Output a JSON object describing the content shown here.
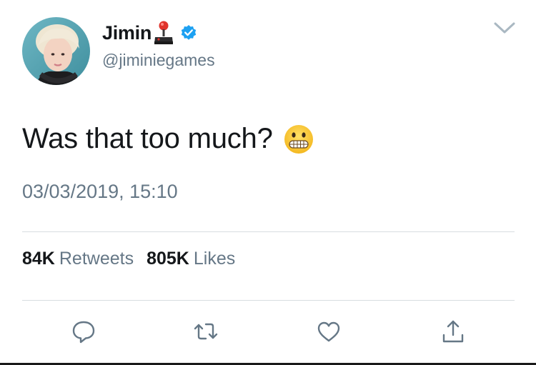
{
  "tweet": {
    "display_name": "Jimin",
    "handle": "@jiminiegames",
    "text": "Was that too much?",
    "emoji": "grimacing-face",
    "timestamp": "03/03/2019, 15:10",
    "retweets_count": "84K",
    "retweets_label": "Retweets",
    "likes_count": "805K",
    "likes_label": "Likes"
  },
  "icons": {
    "name_emoji": "joystick-icon",
    "verified": "verified-badge-icon",
    "menu": "chevron-down-icon",
    "reply": "reply-icon",
    "retweet": "retweet-icon",
    "like": "heart-icon",
    "share": "share-icon"
  },
  "colors": {
    "text_primary": "#14171a",
    "text_secondary": "#657786",
    "verified_blue": "#1da1f2",
    "icon_gray": "#657786",
    "divider": "#d8dde0"
  }
}
